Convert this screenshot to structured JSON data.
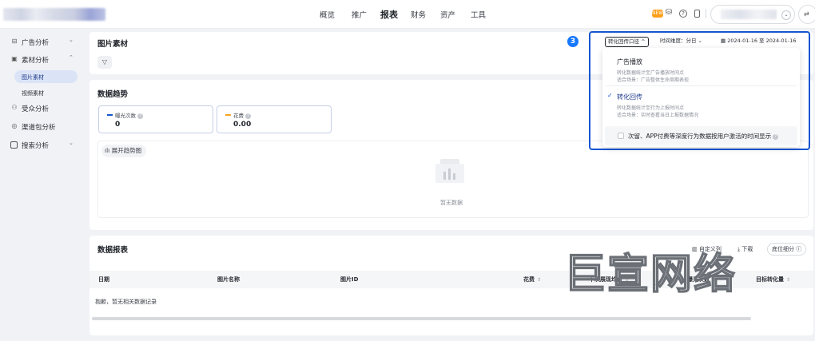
{
  "topnav": {
    "items": [
      {
        "label": "概览",
        "active": false
      },
      {
        "label": "推广",
        "active": false
      },
      {
        "label": "报表",
        "active": true
      },
      {
        "label": "财务",
        "active": false
      },
      {
        "label": "资产",
        "active": false
      },
      {
        "label": "工具",
        "active": false
      }
    ],
    "badge_label": "NEW",
    "switch_icon": "⇄"
  },
  "sidebar": {
    "items": [
      {
        "label": "广告分析",
        "icon": "chart-icon",
        "expanded": false
      },
      {
        "label": "素材分析",
        "icon": "image-icon",
        "expanded": true
      },
      {
        "label": "受众分析",
        "icon": "users-icon",
        "expanded": false
      },
      {
        "label": "渠道包分析",
        "icon": "target-icon",
        "expanded": false
      },
      {
        "label": "搜索分析",
        "icon": "search-box-icon",
        "expanded": false
      }
    ],
    "sub_items": [
      {
        "label": "图片素材",
        "active": true
      },
      {
        "label": "视频素材",
        "active": false
      }
    ]
  },
  "header": {
    "title": "图片素材",
    "step_number": "3",
    "conversion_pill": "转化回传口径 ^",
    "time_dimension": "时间维度：分日 ⌄",
    "date_range": "2024-01-16 至 2024-01-16"
  },
  "dropdown": {
    "options": [
      {
        "title": "广告播放",
        "desc1": "转化数据统计至广告播放时间点",
        "desc2": "适合场景：广告整体生命周期表现",
        "selected": false
      },
      {
        "title": "转化回传",
        "desc1": "转化数据统计至行为上报时间点",
        "desc2": "适合场景：实时查看当日上报数据情况",
        "selected": true
      }
    ],
    "footer_text": "次留、APP付费等深度行为数据按用户激活的时间显示"
  },
  "trend": {
    "title": "数据趋势",
    "metrics": [
      {
        "label": "曝光次数",
        "value": "0",
        "color": "#1656d1"
      },
      {
        "label": "花费",
        "value": "0.00",
        "color": "#f5a623"
      }
    ],
    "expand_label": "展开趋势图",
    "empty_text": "暂无数据"
  },
  "report": {
    "title": "数据报表",
    "actions": {
      "columns": "自定义列",
      "download": "下载",
      "breakdown": "底位细分 ⓘ"
    },
    "columns": [
      {
        "label": "日期",
        "sortable": false
      },
      {
        "label": "图片名称",
        "sortable": false
      },
      {
        "label": "图片ID",
        "sortable": false
      },
      {
        "label": "花费",
        "sortable": true
      },
      {
        "label": "千次展现均价",
        "sortable": true
      },
      {
        "label": "曝光次数",
        "sortable": true
      },
      {
        "label": "目标转化量",
        "sortable": true
      }
    ],
    "empty_text": "抱歉，暂无相关数据记录"
  },
  "watermark": "巨宣网络",
  "colors": {
    "accent": "#1656d1",
    "badge": "#1677ff",
    "cost": "#f5a623"
  }
}
